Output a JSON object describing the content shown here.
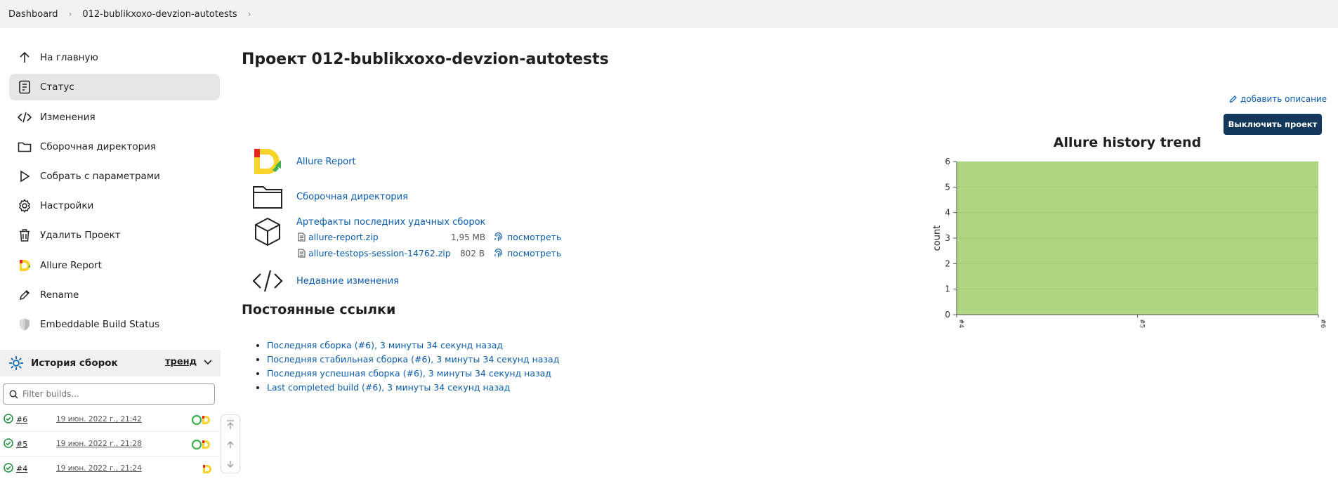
{
  "breadcrumb": [
    {
      "label": "Dashboard"
    },
    {
      "label": "012-bublikxoxo-devzion-autotests"
    }
  ],
  "sidebar": {
    "items": [
      {
        "label": "На главную",
        "icon": "arrow-up-icon"
      },
      {
        "label": "Статус",
        "icon": "document-icon",
        "active": true
      },
      {
        "label": "Изменения",
        "icon": "code-icon"
      },
      {
        "label": "Сборочная директория",
        "icon": "folder-icon"
      },
      {
        "label": "Собрать с параметрами",
        "icon": "play-icon"
      },
      {
        "label": "Настройки",
        "icon": "gear-icon"
      },
      {
        "label": "Удалить Проект",
        "icon": "trash-icon"
      },
      {
        "label": "Allure Report",
        "icon": "allure-logo-icon"
      },
      {
        "label": "Rename",
        "icon": "pencil-icon"
      },
      {
        "label": "Embeddable Build Status",
        "icon": "shield-icon"
      }
    ]
  },
  "build_history": {
    "title": "История сборок",
    "trend_label": "тренд",
    "filter_placeholder": "Filter builds...",
    "builds": [
      {
        "number": "#6",
        "date": "19 июн. 2022 г., 21:42"
      },
      {
        "number": "#5",
        "date": "19 июн. 2022 г., 21:28"
      },
      {
        "number": "#4",
        "date": "19 июн. 2022 г., 21:24"
      }
    ]
  },
  "main": {
    "title": "Проект 012-bublikxoxo-devzion-autotests",
    "add_description": "добавить описание",
    "disable_button": "Выключить проект",
    "links": {
      "allure": "Allure Report",
      "workspace": "Сборочная директория",
      "artifacts_title": "Артефакты последних удачных сборок",
      "recent_changes": "Недавние изменения"
    },
    "artifacts": [
      {
        "name": "allure-report.zip",
        "size": "1,95 MB",
        "view": "посмотреть"
      },
      {
        "name": "allure-testops-session-14762.zip",
        "size": "802 B",
        "view": "посмотреть"
      }
    ],
    "permalinks_title": "Постоянные ссылки",
    "permalinks": [
      "Последняя сборка (#6), 3 минуты 34 секунд назад",
      "Последняя стабильная сборка (#6), 3 минуты 34 секунд назад",
      "Последняя успешная сборка (#6), 3 минуты 34 секунд назад",
      "Last completed build (#6), 3 минуты 34 секунд назад"
    ]
  },
  "chart_data": {
    "type": "area",
    "title": "Allure history trend",
    "ylabel": "count",
    "xlabel": "",
    "categories": [
      "#4",
      "#5",
      "#6"
    ],
    "series": [
      {
        "values": [
          6,
          6,
          6
        ],
        "color": "#aed580"
      }
    ],
    "ylim": [
      0,
      6
    ],
    "yticks": [
      0,
      1,
      2,
      3,
      4,
      5,
      6
    ],
    "grid": true
  },
  "colors": {
    "link": "#0b5cad",
    "primary_button": "#13385b",
    "success": "#1e8c3a",
    "area_fill": "#aed580"
  }
}
